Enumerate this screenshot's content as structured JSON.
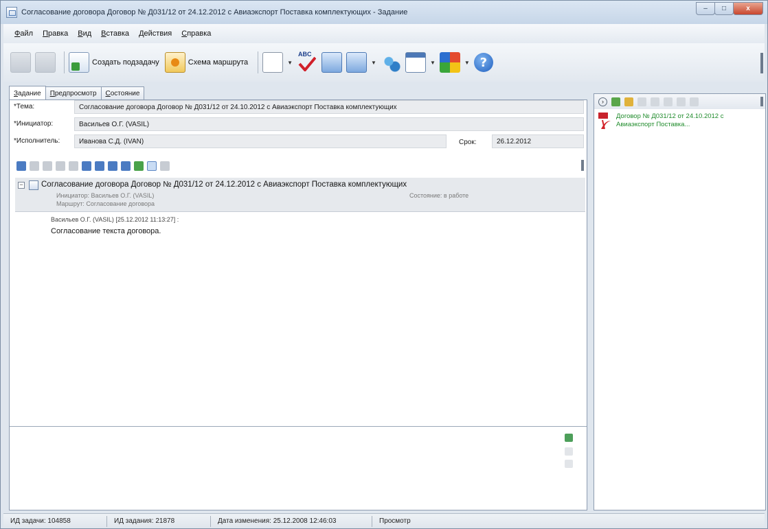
{
  "window": {
    "title": "Согласование договора Договор № Д031/12 от 24.12.2012 с Авиаэкспорт Поставка комплектующих - Задание",
    "controls": {
      "minimize": "–",
      "maximize": "□",
      "close": "x"
    }
  },
  "menu": [
    "Файл",
    "Правка",
    "Вид",
    "Вставка",
    "Действия",
    "Справка"
  ],
  "toolbar": {
    "create_subtask": "Создать подзадачу",
    "route_scheme": "Схема маршрута",
    "spell_label": "ABC"
  },
  "tabs": [
    "Задание",
    "Предпросмотр",
    "Состояние"
  ],
  "form": {
    "subject_label": "*Тема:",
    "subject_value": "Согласование договора Договор № Д031/12 от 24.10.2012 с Авиаэкспорт Поставка комплектующих",
    "initiator_label": "*Инициатор:",
    "initiator_value": "Васильев О.Г. (VASIL)",
    "executor_label": "*Исполнитель:",
    "executor_value": "Иванова С.Д. (IVAN)",
    "deadline_label": "Срок:",
    "deadline_value": "26.12.2012"
  },
  "thread": {
    "title": "Согласование договора Договор № Д031/12 от 24.12.2012 с Авиаэкспорт Поставка комплектующих",
    "initiator": "Инициатор: Васильев О.Г. (VASIL)",
    "route": "Маршрут: Согласование договора",
    "state": "Состояние: в работе",
    "comment_author": "Васильев О.Г. (VASIL) [25.12.2012 11:13:27] :",
    "comment_text": "Согласование текста договора."
  },
  "attachments": [
    {
      "name": "Договор № Д031/12 от 24.10.2012 с Авиаэкспорт Поставка..."
    }
  ],
  "status": {
    "task_id": "ИД задачи: 104858",
    "assignment_id": "ИД задания: 21878",
    "modified": "Дата изменения: 25.12.2008 12:46:03",
    "mode": "Просмотр"
  }
}
